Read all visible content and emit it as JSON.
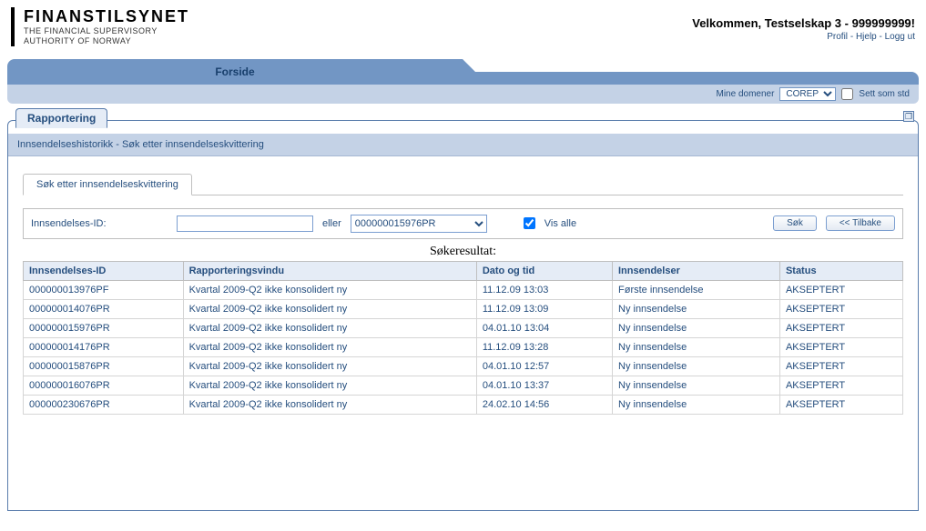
{
  "logo": {
    "title": "FINANSTILSYNET",
    "sub1": "THE FINANCIAL SUPERVISORY",
    "sub2": "AUTHORITY OF NORWAY"
  },
  "welcome": {
    "text": "Velkommen, Testselskap 3 - 999999999!",
    "profil": "Profil",
    "hjelp": "Hjelp",
    "loggut": "Logg ut"
  },
  "nav": {
    "forside": "Forside"
  },
  "domain_bar": {
    "label": "Mine domener",
    "selected": "COREP",
    "set_std": "Sett som std"
  },
  "section_tab": "Rapportering",
  "panel_header": "Innsendelseshistorikk - Søk etter innsendelseskvittering",
  "subtab": "Søk etter innsendelseskvittering",
  "search": {
    "label": "Innsendelses-ID:",
    "value": "",
    "eller": "eller",
    "dropdown_selected": "000000015976PR",
    "vis_alle": "Vis alle",
    "sok": "Søk",
    "tilbake": "<< Tilbake"
  },
  "result_title": "Søkeresultat:",
  "columns": {
    "id": "Innsendelses-ID",
    "vindu": "Rapporteringsvindu",
    "dato": "Dato og tid",
    "innsendelser": "Innsendelser",
    "status": "Status"
  },
  "rows": [
    {
      "id": "000000013976PF",
      "vindu": "Kvartal 2009-Q2 ikke konsolidert ny",
      "dato": "11.12.09 13:03",
      "inns": "Første innsendelse",
      "status": "AKSEPTERT"
    },
    {
      "id": "000000014076PR",
      "vindu": "Kvartal 2009-Q2 ikke konsolidert ny",
      "dato": "11.12.09 13:09",
      "inns": "Ny innsendelse",
      "status": "AKSEPTERT"
    },
    {
      "id": "000000015976PR",
      "vindu": "Kvartal 2009-Q2 ikke konsolidert ny",
      "dato": "04.01.10 13:04",
      "inns": "Ny innsendelse",
      "status": "AKSEPTERT"
    },
    {
      "id": "000000014176PR",
      "vindu": "Kvartal 2009-Q2 ikke konsolidert ny",
      "dato": "11.12.09 13:28",
      "inns": "Ny innsendelse",
      "status": "AKSEPTERT"
    },
    {
      "id": "000000015876PR",
      "vindu": "Kvartal 2009-Q2 ikke konsolidert ny",
      "dato": "04.01.10 12:57",
      "inns": "Ny innsendelse",
      "status": "AKSEPTERT"
    },
    {
      "id": "000000016076PR",
      "vindu": "Kvartal 2009-Q2 ikke konsolidert ny",
      "dato": "04.01.10 13:37",
      "inns": "Ny innsendelse",
      "status": "AKSEPTERT"
    },
    {
      "id": "000000230676PR",
      "vindu": "Kvartal 2009-Q2 ikke konsolidert ny",
      "dato": "24.02.10 14:56",
      "inns": "Ny innsendelse",
      "status": "AKSEPTERT"
    }
  ]
}
